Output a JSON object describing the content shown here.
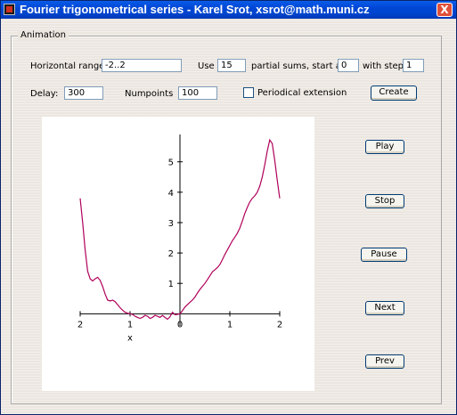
{
  "window": {
    "title": "Fourier trigonometrical series - Karel Srot, xsrot@math.muni.cz",
    "close_glyph": "X"
  },
  "animation": {
    "group_label": "Animation",
    "horizontal_range_label": "Horizontal range:",
    "horizontal_range_value": "-2..2",
    "use_label": "Use",
    "use_value": "15",
    "partial_sums_label": "partial sums, start at",
    "start_value": "0",
    "with_step_label": "with step",
    "step_value": "1",
    "delay_label": "Delay:",
    "delay_value": "300",
    "numpoints_label": "Numpoints",
    "numpoints_value": "100",
    "periodical_label": "Periodical extension",
    "periodical_checked": false,
    "create_label": "Create"
  },
  "controls": {
    "play": "Play",
    "stop": "Stop",
    "pause": "Pause",
    "next": "Next",
    "prev": "Prev"
  },
  "chart_data": {
    "type": "line",
    "xlabel": "x",
    "xlim": [
      -2,
      2
    ],
    "ylim": [
      -0.4,
      5.9
    ],
    "x_ticks": [
      -2,
      -1,
      0,
      1,
      2
    ],
    "x_tick_labels": [
      "2",
      "1",
      "0",
      "1",
      "2"
    ],
    "y_ticks": [
      1,
      2,
      3,
      4,
      5
    ],
    "y_tick_labels": [
      "1",
      "2",
      "3",
      "4",
      "5"
    ],
    "series_color": "#b0005a",
    "series": [
      {
        "x": [
          -2.0,
          -1.95,
          -1.9,
          -1.85,
          -1.8,
          -1.75,
          -1.7,
          -1.65,
          -1.6,
          -1.55,
          -1.5,
          -1.45,
          -1.4,
          -1.35,
          -1.3,
          -1.25,
          -1.2,
          -1.15,
          -1.1,
          -1.05,
          -1.0,
          -0.95,
          -0.9,
          -0.85,
          -0.8,
          -0.75,
          -0.7,
          -0.65,
          -0.6,
          -0.55,
          -0.5,
          -0.45,
          -0.4,
          -0.35,
          -0.3,
          -0.25,
          -0.2,
          -0.15,
          -0.1,
          -0.05,
          0.0,
          0.05,
          0.1,
          0.15,
          0.2,
          0.25,
          0.3,
          0.35,
          0.4,
          0.45,
          0.5,
          0.55,
          0.6,
          0.65,
          0.7,
          0.75,
          0.8,
          0.85,
          0.9,
          0.95,
          1.0,
          1.05,
          1.1,
          1.15,
          1.2,
          1.25,
          1.3,
          1.35,
          1.4,
          1.45,
          1.5,
          1.55,
          1.6,
          1.65,
          1.7,
          1.75,
          1.8,
          1.85,
          1.9,
          1.95,
          2.0
        ],
        "y": [
          3.8,
          3.0,
          2.1,
          1.4,
          1.15,
          1.08,
          1.15,
          1.2,
          1.1,
          0.9,
          0.65,
          0.45,
          0.42,
          0.45,
          0.4,
          0.3,
          0.2,
          0.12,
          0.05,
          0.02,
          0.0,
          -0.02,
          -0.08,
          -0.12,
          -0.15,
          -0.12,
          -0.05,
          -0.08,
          -0.15,
          -0.12,
          -0.05,
          -0.08,
          -0.12,
          -0.05,
          -0.12,
          -0.18,
          -0.1,
          0.05,
          -0.03,
          -0.02,
          0.0,
          0.1,
          0.22,
          0.3,
          0.38,
          0.45,
          0.55,
          0.68,
          0.8,
          0.9,
          1.0,
          1.12,
          1.25,
          1.38,
          1.45,
          1.52,
          1.62,
          1.78,
          1.95,
          2.1,
          2.25,
          2.4,
          2.52,
          2.65,
          2.82,
          3.05,
          3.3,
          3.5,
          3.68,
          3.8,
          3.88,
          4.0,
          4.2,
          4.5,
          4.9,
          5.35,
          5.72,
          5.6,
          5.05,
          4.4,
          3.8
        ]
      }
    ]
  }
}
